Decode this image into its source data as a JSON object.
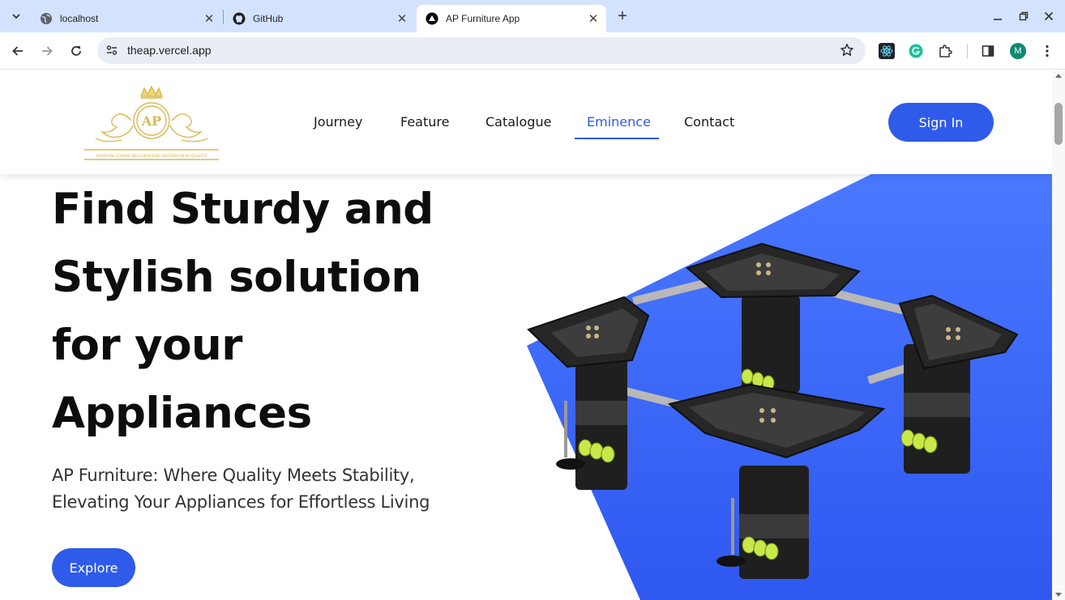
{
  "browser": {
    "tabs": [
      {
        "title": "localhost",
        "icon": "globe-icon"
      },
      {
        "title": "GitHub",
        "icon": "github-icon"
      },
      {
        "title": "AP Furniture App",
        "icon": "vercel-triangle-icon",
        "active": true
      }
    ],
    "url": "theap.vercel.app",
    "profile_initial": "M",
    "colors": {
      "tabstrip": "#d3e3fd",
      "omnibox": "#e9eef6",
      "profile": "#0b8a6f"
    }
  },
  "site": {
    "logo_text": "AP",
    "logo_tagline": "MANUFACTURING RELATIONSHIP DISTRIBUTION QUALITY",
    "nav": [
      {
        "label": "Journey"
      },
      {
        "label": "Feature"
      },
      {
        "label": "Catalogue"
      },
      {
        "label": "Eminence",
        "active": true
      },
      {
        "label": "Contact"
      }
    ],
    "signin_label": "Sign In",
    "hero": {
      "title_lines": [
        "Find Sturdy and",
        "Stylish solution",
        "for your",
        "Appliances"
      ],
      "subtitle_lines": [
        "AP Furniture: Where Quality Meets Stability,",
        "Elevating Your Appliances for Effortless Living"
      ],
      "cta_label": "Explore"
    },
    "colors": {
      "accent": "#2f5bea",
      "text": "#0d0d0d",
      "logo_gold": "#d8b95a"
    }
  }
}
